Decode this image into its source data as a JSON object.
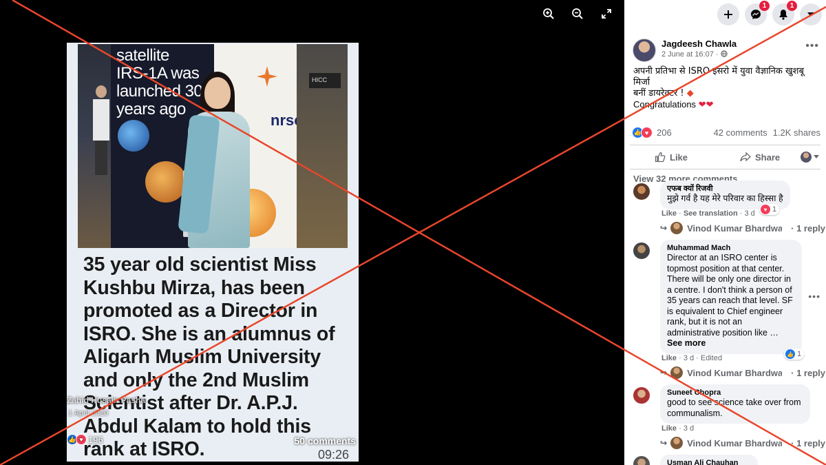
{
  "viewer": {
    "tools": {
      "zoom_in_icon": "zoom-in-icon",
      "zoom_out_icon": "zoom-out-icon",
      "fullscreen_icon": "fullscreen-icon"
    },
    "photo": {
      "banner_line1": "satellite",
      "banner_line2": "IRS-1A was",
      "banner_line3": "launched 30",
      "banner_line4": "years ago",
      "banner_logo_text": "nrsc",
      "hall_sign": "HICC",
      "headline": "35 year old  scientist Miss Kushbu Mirza, has been promoted as a Director in ISRO. She is an alumnus of Aligarh Muslim University and only the 2nd Muslim Scientist after Dr. A.P.J. Abdul Kalam to hold this rank at ISRO.",
      "overlay_name": "Zahid Husain Pasha",
      "overlay_date": "1 April 2020",
      "overlay_reactions": "196",
      "overlay_comments": "50 comments",
      "overlay_time": "09:26"
    }
  },
  "topbar": {
    "create_icon": "plus-icon",
    "messenger_badge": "1",
    "notifications_badge": "1"
  },
  "post": {
    "author": "Jagdeesh Chawla",
    "time": "2 June at 16:07",
    "audience": "·",
    "text_line1": "अपनी प्रतिभा से ISRO इसरो में युवा वैज्ञानिक खुशबू मिर्जा",
    "text_line2": "बनीं डायरेक्टर !",
    "text_line3": "Congratulations",
    "reaction_count": "206",
    "comments_count": "42 comments",
    "shares_count": "1.2K shares",
    "like_label": "Like",
    "share_label": "Share",
    "view_more": "View 32 more comments"
  },
  "comments": [
    {
      "name": "एफब क्यों रिजवी",
      "text": "मुझे गर्व है यह मेरे परिवार का हिस्सा है",
      "react_count": "1",
      "like": "Like",
      "sep1": "·",
      "translation": "See translation",
      "sep2": "·",
      "time": "3 d",
      "reply_name": "Vinod Kumar Bhardwaj",
      "reply_count": "· 1 reply"
    },
    {
      "name": "Muhammad Mach",
      "text": "Director at an ISRO center is topmost position at that center. There will be only one director in a centre. I don't think a person of 35 years can reach that level. SF is equivalent to Chief engineer rank, but it is not an administrative position like …",
      "see_more": "See more",
      "react_count": "1",
      "like": "Like",
      "sep1": "·",
      "time": "3 d",
      "sep2": "·",
      "edited": "Edited",
      "reply_name": "Vinod Kumar Bhardwaj",
      "reply_count": "· 1 reply"
    },
    {
      "name": "Suneet Chopra",
      "text": "good to see science take over from communalism.",
      "like": "Like",
      "sep1": "·",
      "time": "3 d",
      "reply_name": "Vinod Kumar Bhardwaj",
      "reply_count": "· 1 reply"
    },
    {
      "name": "Usman Ali Chauhan"
    }
  ],
  "colors": {
    "x_mark": "#e8462b",
    "fb_blue": "#1877f2",
    "love_red": "#f33e58"
  }
}
